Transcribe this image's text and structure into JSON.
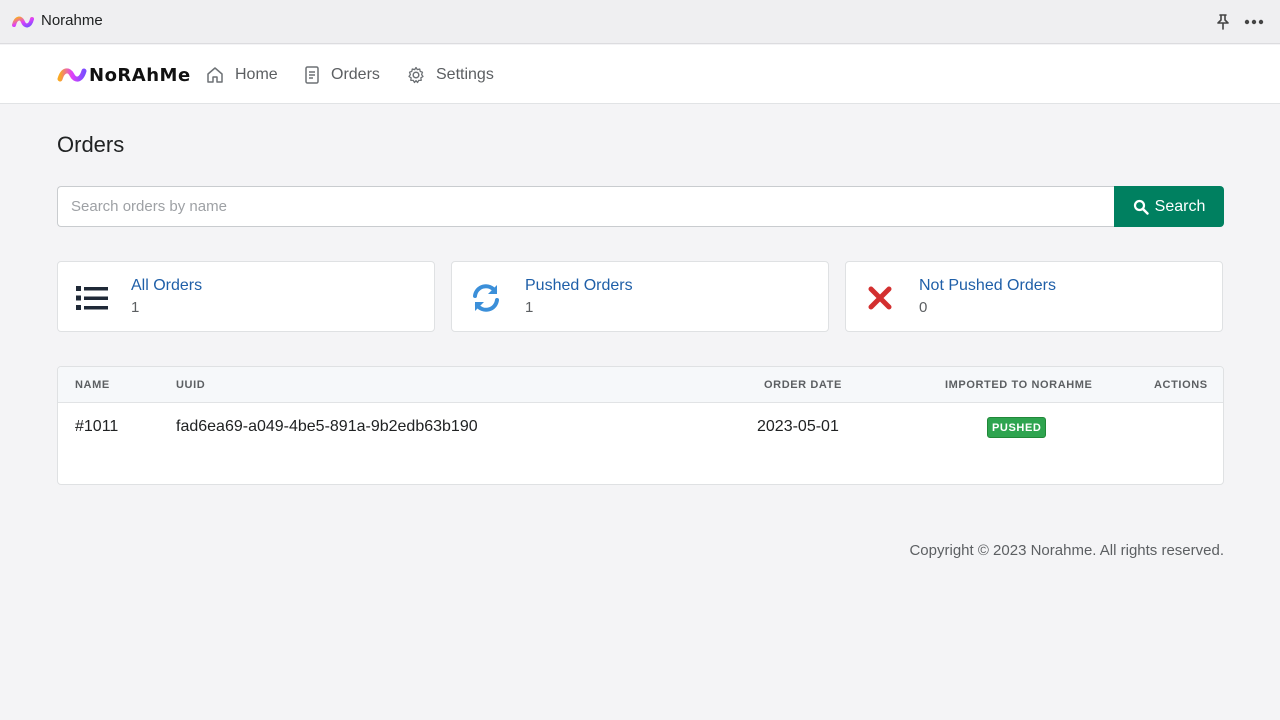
{
  "window": {
    "title": "Norahme"
  },
  "navbar": {
    "brand": "NoRAhMe",
    "items": [
      {
        "label": "Home",
        "icon": "home-icon"
      },
      {
        "label": "Orders",
        "icon": "document-icon"
      },
      {
        "label": "Settings",
        "icon": "gear-icon"
      }
    ]
  },
  "page": {
    "title": "Orders"
  },
  "search": {
    "placeholder": "Search orders by name",
    "value": "",
    "button_label": "Search"
  },
  "stats": [
    {
      "label": "All Orders",
      "count": "1",
      "icon": "list-icon",
      "color": "#1f2937"
    },
    {
      "label": "Pushed Orders",
      "count": "1",
      "icon": "sync-icon",
      "color": "#3b8fd9"
    },
    {
      "label": "Not Pushed Orders",
      "count": "0",
      "icon": "close-icon",
      "color": "#d32f2f"
    }
  ],
  "table": {
    "columns": [
      "NAME",
      "UUID",
      "ORDER DATE",
      "IMPORTED TO NORAHME",
      "ACTIONS"
    ],
    "rows": [
      {
        "name": "#1011",
        "uuid": "fad6ea69-a049-4be5-891a-9b2edb63b190",
        "order_date": "2023-05-01",
        "status": "PUSHED"
      }
    ]
  },
  "footer": {
    "copyright": "Copyright © 2023 Norahme. All rights reserved."
  },
  "colors": {
    "accent": "#008060",
    "link": "#1f5fa8",
    "badge_green": "#2ea44f"
  }
}
